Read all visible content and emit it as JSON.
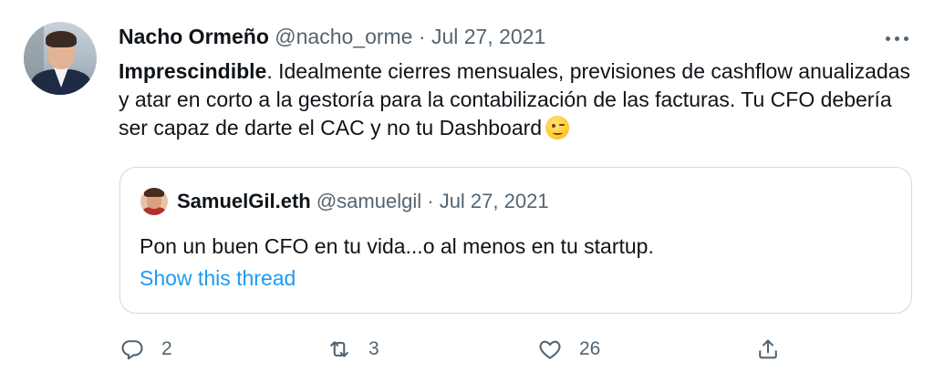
{
  "tweet": {
    "author_name": "Nacho Ormeño",
    "handle": "@nacho_orme",
    "separator": "·",
    "date": "Jul 27, 2021",
    "text_bold": "Imprescindible",
    "text_rest": ". Idealmente cierres mensuales, previsiones de cashflow anualizadas y atar en corto a la gestoría para la contabilización de las facturas. Tu CFO debería ser capaz de darte el CAC y no tu Dashboard",
    "emoji": "winking-face-emoji"
  },
  "quote": {
    "author_name": "SamuelGil.eth",
    "handle": "@samuelgil",
    "separator": "·",
    "date": "Jul 27, 2021",
    "text": "Pon un buen CFO en tu vida...o al menos en tu startup.",
    "show_thread": "Show this thread"
  },
  "actions": {
    "reply_count": "2",
    "retweet_count": "3",
    "like_count": "26"
  },
  "colors": {
    "text": "#0f1419",
    "secondary": "#536471",
    "link": "#1d9bf0",
    "border": "#cfd9de"
  }
}
